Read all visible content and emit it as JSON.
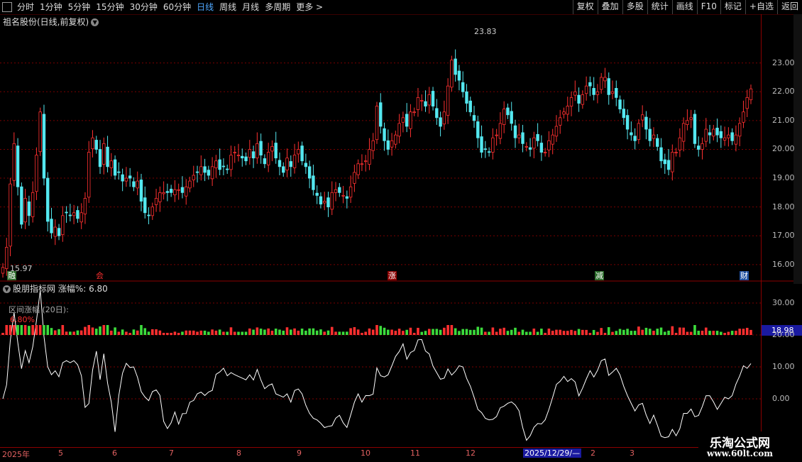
{
  "colors": {
    "up": "#ff3030",
    "down": "#54e8f0",
    "grid": "#8b0000",
    "green": "#3cdc3c",
    "line": "#ffffff",
    "selected": "#1a1aa0"
  },
  "toolbar": {
    "left": [
      "分时",
      "1分钟",
      "5分钟",
      "15分钟",
      "30分钟",
      "60分钟",
      "日线",
      "周线",
      "月线",
      "多周期",
      "更多 >"
    ],
    "active": "日线",
    "right": [
      "复权",
      "叠加",
      "多股",
      "统计",
      "画线",
      "F10",
      "标记",
      "+自选",
      "返回"
    ]
  },
  "chart_title": "祖名股份(日线,前复权)",
  "price_high_label": "23.83",
  "price_low_label": "15.97",
  "price_axis": [
    "23.00",
    "22.00",
    "21.00",
    "20.00",
    "19.00",
    "18.00",
    "17.00",
    "16.00"
  ],
  "events": [
    "融",
    "会",
    "涨",
    "减",
    "财"
  ],
  "indicator": {
    "title": "股朋指标网 涨幅%: 6.80",
    "label": "区间涨幅 (20日):",
    "value": "6.80%",
    "current_box": "18.98",
    "axis": [
      "30.00",
      "20.00",
      "10.00",
      "0.00"
    ]
  },
  "x_axis": [
    "2025年",
    "5",
    "6",
    "7",
    "8",
    "9",
    "10",
    "11",
    "12",
    "2025/12/29/—",
    "2",
    "3"
  ],
  "watermark": {
    "title": "乐淘公式网",
    "url": "www.60lt.com"
  },
  "chart_data": {
    "type": "candlestick",
    "price_range": [
      15.7,
      24.2
    ],
    "close": [
      15.9,
      16.6,
      18.8,
      20.2,
      18.7,
      17.4,
      18.3,
      17.7,
      18.5,
      19.8,
      21.3,
      19.0,
      17.5,
      17.1,
      17.3,
      17.0,
      17.7,
      17.8,
      17.7,
      17.8,
      17.6,
      17.8,
      18.3,
      19.9,
      20.4,
      20.0,
      19.4,
      20.2,
      19.4,
      19.6,
      19.1,
      19.2,
      18.9,
      19.0,
      19.0,
      18.7,
      18.9,
      18.2,
      17.8,
      17.7,
      18.0,
      18.3,
      18.5,
      18.5,
      18.5,
      18.5,
      18.6,
      18.6,
      18.5,
      18.7,
      18.9,
      19.1,
      19.2,
      19.4,
      19.2,
      19.1,
      19.4,
      19.6,
      19.3,
      19.4,
      19.3,
      19.8,
      19.9,
      19.8,
      19.7,
      19.6,
      20.0,
      19.7,
      20.2,
      19.8,
      19.5,
      19.9,
      20.1,
      19.7,
      19.4,
      19.2,
      19.7,
      19.4,
      19.8,
      20.0,
      19.6,
      19.4,
      19.0,
      18.6,
      18.4,
      18.1,
      18.2,
      18.0,
      18.5,
      18.6,
      18.5,
      18.4,
      18.3,
      18.7,
      19.2,
      19.5,
      19.5,
      19.6,
      20.0,
      20.3,
      21.5,
      20.8,
      20.3,
      20.0,
      20.3,
      20.5,
      20.9,
      21.1,
      20.8,
      21.3,
      21.3,
      21.8,
      21.7,
      21.5,
      21.9,
      21.5,
      21.1,
      20.8,
      21.3,
      22.2,
      23.1,
      22.6,
      22.4,
      22.0,
      21.6,
      21.3,
      21.0,
      20.4,
      19.9,
      20.0,
      19.9,
      20.4,
      20.5,
      20.9,
      21.4,
      21.2,
      20.9,
      20.4,
      20.5,
      20.2,
      20.1,
      20.0,
      20.4,
      20.3,
      19.9,
      19.9,
      20.3,
      20.5,
      20.8,
      21.1,
      21.3,
      21.5,
      21.8,
      22.0,
      21.6,
      21.9,
      22.2,
      22.2,
      21.9,
      22.0,
      22.5,
      22.5,
      21.9,
      22.0,
      21.8,
      21.4,
      21.1,
      20.7,
      20.5,
      20.3,
      20.9,
      21.2,
      20.7,
      20.3,
      20.5,
      20.1,
      19.6,
      19.5,
      19.3,
      19.9,
      19.9,
      20.4,
      20.9,
      21.0,
      21.1,
      20.2,
      20.0,
      20.2,
      20.7,
      20.5,
      20.7,
      20.5,
      20.4,
      20.4,
      20.5,
      20.3,
      20.5,
      20.9,
      21.3,
      21.8,
      22.1
    ]
  }
}
